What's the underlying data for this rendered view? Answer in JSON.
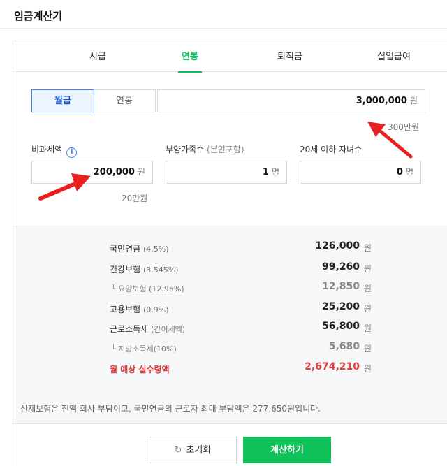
{
  "page": {
    "title": "임금계산기"
  },
  "tabs": [
    {
      "label": "시급"
    },
    {
      "label": "연봉"
    },
    {
      "label": "퇴직금"
    },
    {
      "label": "실업급여"
    }
  ],
  "pay_type": {
    "monthly": "월급",
    "annual": "연봉"
  },
  "salary": {
    "value": "3,000,000",
    "unit": "원",
    "hint": "300만원"
  },
  "tax_free": {
    "label": "비과세액",
    "info_icon": "i",
    "value": "200,000",
    "unit": "원",
    "hint": "20만원"
  },
  "dependents": {
    "label": "부양가족수",
    "label_sub": "(본인포함)",
    "value": "1",
    "unit": "명"
  },
  "children": {
    "label": "20세 이하 자녀수",
    "value": "0",
    "unit": "명"
  },
  "results": [
    {
      "name": "국민연금",
      "pct": "(4.5%)",
      "amount": "126,000",
      "unit": "원"
    },
    {
      "name": "건강보험",
      "pct": "(3.545%)",
      "amount": "99,260",
      "unit": "원"
    },
    {
      "name": "└ 요양보험",
      "pct": "(12.95%)",
      "amount": "12,850",
      "unit": "원"
    },
    {
      "name": "고용보험",
      "pct": "(0.9%)",
      "amount": "25,200",
      "unit": "원"
    },
    {
      "name": "근로소득세",
      "pct": "(간이세액)",
      "amount": "56,800",
      "unit": "원"
    },
    {
      "name": "└ 지방소득세",
      "pct": "(10%)",
      "amount": "5,680",
      "unit": "원"
    },
    {
      "name": "월 예상 실수령액",
      "pct": "",
      "amount": "2,674,210",
      "unit": "원"
    }
  ],
  "notice": "산재보험은 전액 회사 부담이고, 국민연금의 근로자 최대 부담액은 277,650원입니다.",
  "buttons": {
    "reset_icon": "↻",
    "reset": "초기화",
    "calc": "계산하기"
  },
  "colors": {
    "accent_green": "#03c75a",
    "accent_blue": "#3b82f6",
    "total_red": "#e23b3b",
    "annotation_arrow": "#e8201f"
  }
}
